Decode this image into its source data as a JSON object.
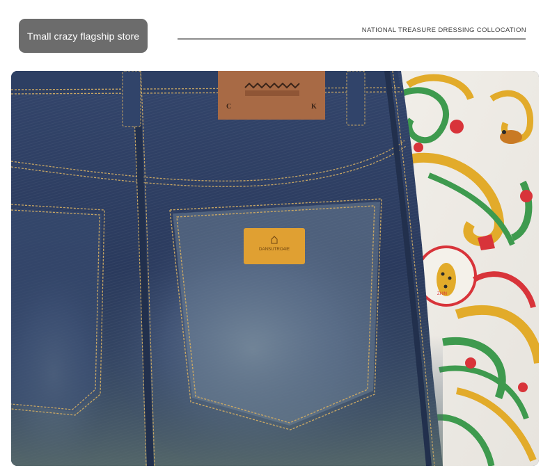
{
  "store_badge": {
    "label": "Tmall crazy flagship store"
  },
  "header": {
    "caption": "NATIONAL TREASURE DRESSING COLLOCATION"
  },
  "photo": {
    "waist_patch_letters": [
      "C",
      "K"
    ],
    "pocket_patch_text": "DANSUTRO4IE",
    "print_badge_text": "ZHIN",
    "colors": {
      "denim_dark": "#243556",
      "denim_mid": "#3b5179",
      "denim_fade": "#7f91a0",
      "stitch": "#c9a764",
      "leather_patch": "#a86a45",
      "pocket_patch": "#e0a032",
      "print_green": "#3e9a4e",
      "print_gold": "#e2ab2a",
      "print_red": "#d8343a"
    }
  }
}
